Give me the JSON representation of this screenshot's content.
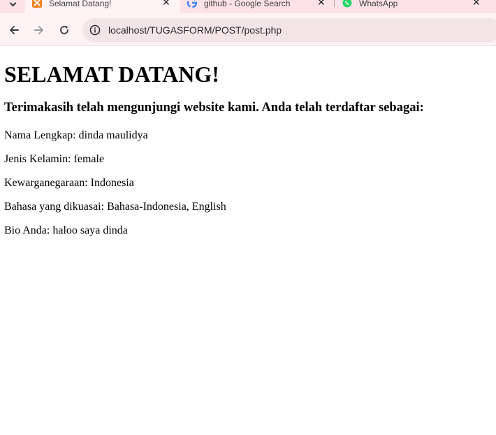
{
  "browser": {
    "tabs": [
      {
        "title": "Selamat Datang!",
        "active": true,
        "favicon": "xampp-favicon-icon"
      },
      {
        "title": "github - Google Search",
        "active": false,
        "favicon": "google-favicon-icon"
      },
      {
        "title": "WhatsApp",
        "active": false,
        "favicon": "whatsapp-favicon-icon"
      }
    ],
    "url": "localhost/TUGASFORM/POST/post.php",
    "colors": {
      "tabbar_bg": "#fde3e8",
      "toolbar_bg": "#fff3f5",
      "omnibox_bg": "#f3e4e8"
    }
  },
  "page": {
    "heading": "SELAMAT DATANG!",
    "subheading": "Terimakasih telah mengunjungi website kami. Anda telah terdaftar sebagai:",
    "fields": [
      "Nama Lengkap: dinda maulidya",
      "Jenis Kelamin: female",
      "Kewarganegaraan: Indonesia",
      "Bahasa yang dikuasai: Bahasa-Indonesia, English",
      "Bio Anda: haloo saya dinda"
    ]
  }
}
